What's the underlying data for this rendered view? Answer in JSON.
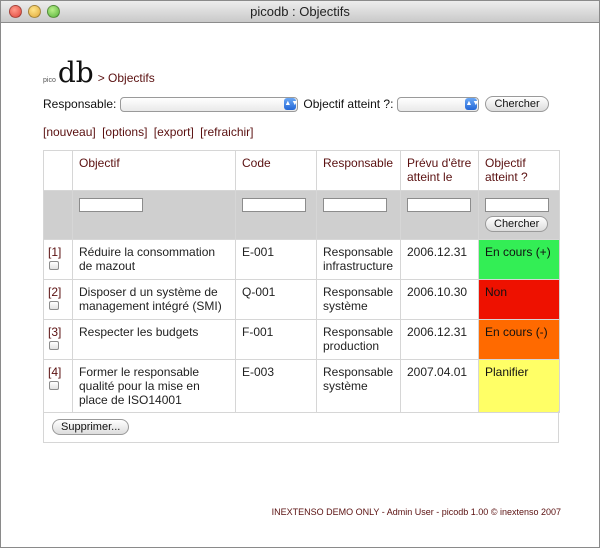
{
  "window": {
    "title": "picodb : Objectifs"
  },
  "brand": {
    "prefix": "pico",
    "name": "db",
    "breadcrumb": "> Objectifs"
  },
  "filters": {
    "responsable_label": "Responsable:",
    "responsable_value": "",
    "objectif_label": "Objectif atteint ?:",
    "objectif_value": "",
    "search_button": "Chercher"
  },
  "actions": {
    "nouveau": "[nouveau]",
    "options": "[options]",
    "export": "[export]",
    "refraichir": "[refraichir]"
  },
  "table": {
    "headers": [
      "Objectif",
      "Code",
      "Responsable",
      "Prévu d'être atteint le",
      "Objectif atteint ?"
    ],
    "filter_button": "Chercher",
    "rows": [
      {
        "id": "[1]",
        "objectif": "Réduire la consommation de mazout",
        "code": "E-001",
        "responsable": "Responsable infrastructure",
        "date": "2006.12.31",
        "status": "En cours (+)",
        "status_color": "#33ee55"
      },
      {
        "id": "[2]",
        "objectif": "Disposer d un système de management intégré (SMI)",
        "code": "Q-001",
        "responsable": "Responsable système",
        "date": "2006.10.30",
        "status": "Non",
        "status_color": "#ee1100"
      },
      {
        "id": "[3]",
        "objectif": "Respecter les budgets",
        "code": "F-001",
        "responsable": "Responsable production",
        "date": "2006.12.31",
        "status": "En cours (-)",
        "status_color": "#ff6a00"
      },
      {
        "id": "[4]",
        "objectif": "Former le responsable qualité pour la mise en place de ISO14001",
        "code": "E-003",
        "responsable": "Responsable système",
        "date": "2007.04.01",
        "status": "Planifier",
        "status_color": "#ffff66"
      }
    ],
    "delete_button": "Supprimer..."
  },
  "footer": "INEXTENSO DEMO ONLY - Admin User - picodb 1.00 © inextenso 2007"
}
